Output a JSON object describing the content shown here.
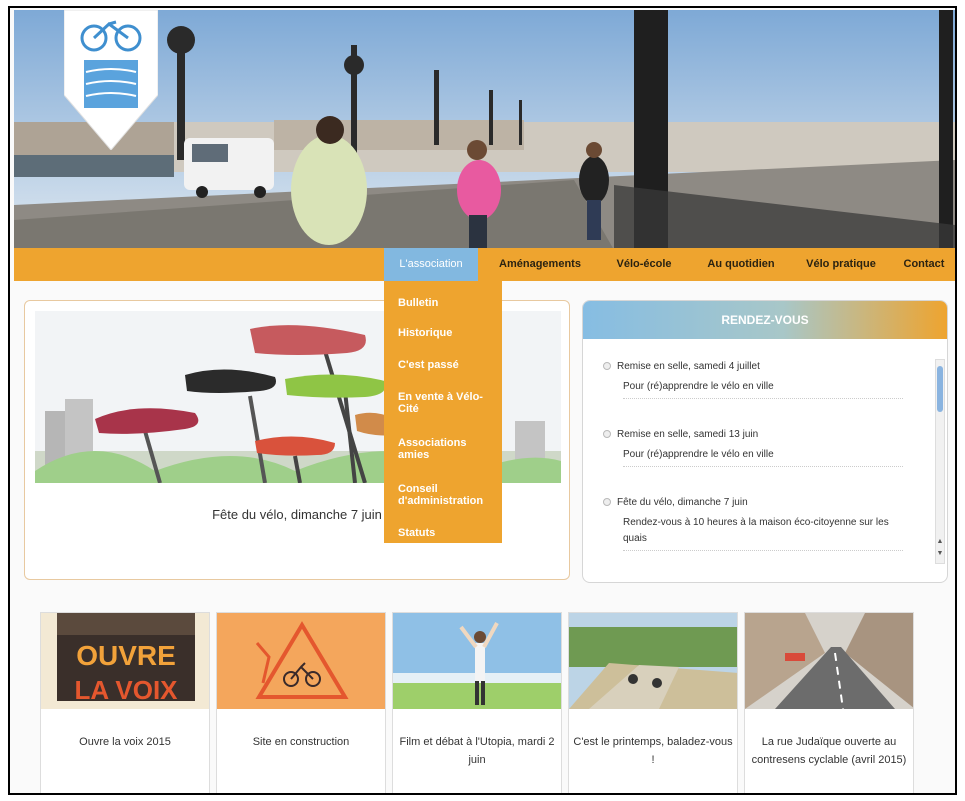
{
  "nav": {
    "items": [
      "L'association",
      "Aménagements",
      "Vélo-école",
      "Au quotidien",
      "Vélo pratique",
      "Contact"
    ],
    "active_index": 0
  },
  "dropdown": {
    "items": [
      "Bulletin",
      "Historique",
      "C'est passé",
      "En vente à Vélo-Cité",
      "Associations amies",
      "Conseil d'administration",
      "Statuts"
    ]
  },
  "slideshow": {
    "caption": "Fête du vélo, dimanche 7 juin"
  },
  "rendezvous": {
    "title": "RENDEZ-VOUS",
    "events": [
      {
        "title": "Remise en selle, samedi 4 juillet",
        "description": "Pour (ré)apprendre le vélo en ville"
      },
      {
        "title": "Remise en selle, samedi 13 juin",
        "description": "Pour (ré)apprendre le vélo en ville"
      },
      {
        "title": "Fête du vélo, dimanche 7 juin",
        "description": "Rendez-vous à 10 heures à la maison éco-citoyenne sur les quais"
      }
    ]
  },
  "cards": [
    {
      "caption": "Ouvre la voix 2015",
      "poster_line1": "OUVRE",
      "poster_line2": "LA VOIX"
    },
    {
      "caption": "Site en construction"
    },
    {
      "caption": "Film et débat à l'Utopia, mardi 2 juin"
    },
    {
      "caption": "C'est le printemps, baladez-vous !"
    },
    {
      "caption": "La rue Judaïque ouverte au contresens cyclable (avril 2015)"
    }
  ],
  "colors": {
    "accent": "#eea42f",
    "nav_active": "#82b8e0",
    "text": "#333333"
  },
  "icons": {
    "logo": "bicycle-logo-icon",
    "scroll_up": "arrow-up-icon",
    "scroll_down": "arrow-down-icon"
  }
}
